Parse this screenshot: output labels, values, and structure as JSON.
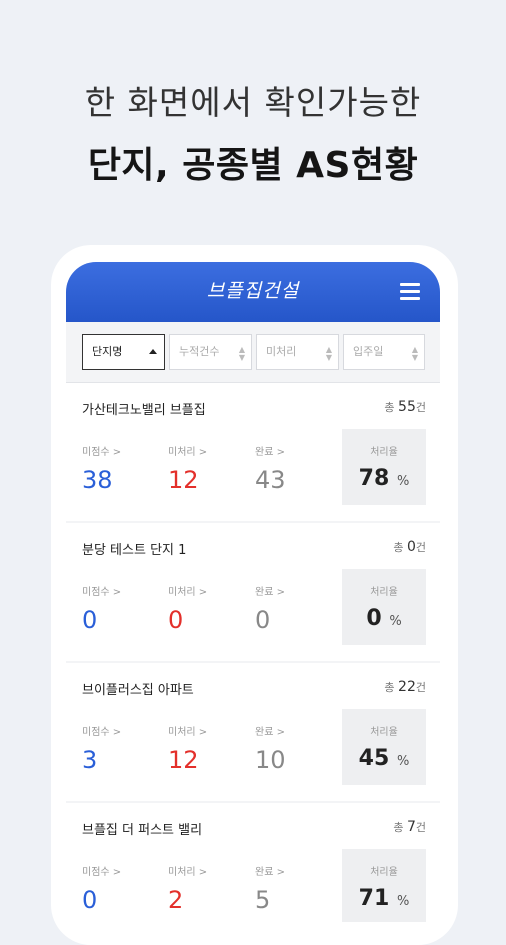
{
  "promo": {
    "line1": "한 화면에서 확인가능한",
    "line2": "단지, 공종별 AS현황"
  },
  "app": {
    "brand": "브플집건설",
    "menu_icon": "hamburger-menu-icon",
    "accent": "#2a5fd8"
  },
  "filters": [
    {
      "label": "단지명",
      "active": true
    },
    {
      "label": "누적건수",
      "active": false
    },
    {
      "label": "미처리",
      "active": false
    },
    {
      "label": "입주일",
      "active": false
    }
  ],
  "labels": {
    "inspection": "미점수 >",
    "unprocessed": "미처리 >",
    "done": "완료 >",
    "rate": "처리율",
    "total_prefix": "총",
    "total_suffix": "건",
    "percent": "%"
  },
  "complexes": [
    {
      "name": "가산테크노밸리 브플집",
      "total": "55",
      "inspection": "38",
      "unprocessed": "12",
      "done": "43",
      "rate": "78"
    },
    {
      "name": "분당 테스트 단지 1",
      "total": "0",
      "inspection": "0",
      "unprocessed": "0",
      "done": "0",
      "rate": "0"
    },
    {
      "name": "브이플러스집 아파트",
      "total": "22",
      "inspection": "3",
      "unprocessed": "12",
      "done": "10",
      "rate": "45"
    },
    {
      "name": "브플집 더 퍼스트 밸리",
      "total": "7",
      "inspection": "0",
      "unprocessed": "2",
      "done": "5",
      "rate": "71"
    }
  ]
}
